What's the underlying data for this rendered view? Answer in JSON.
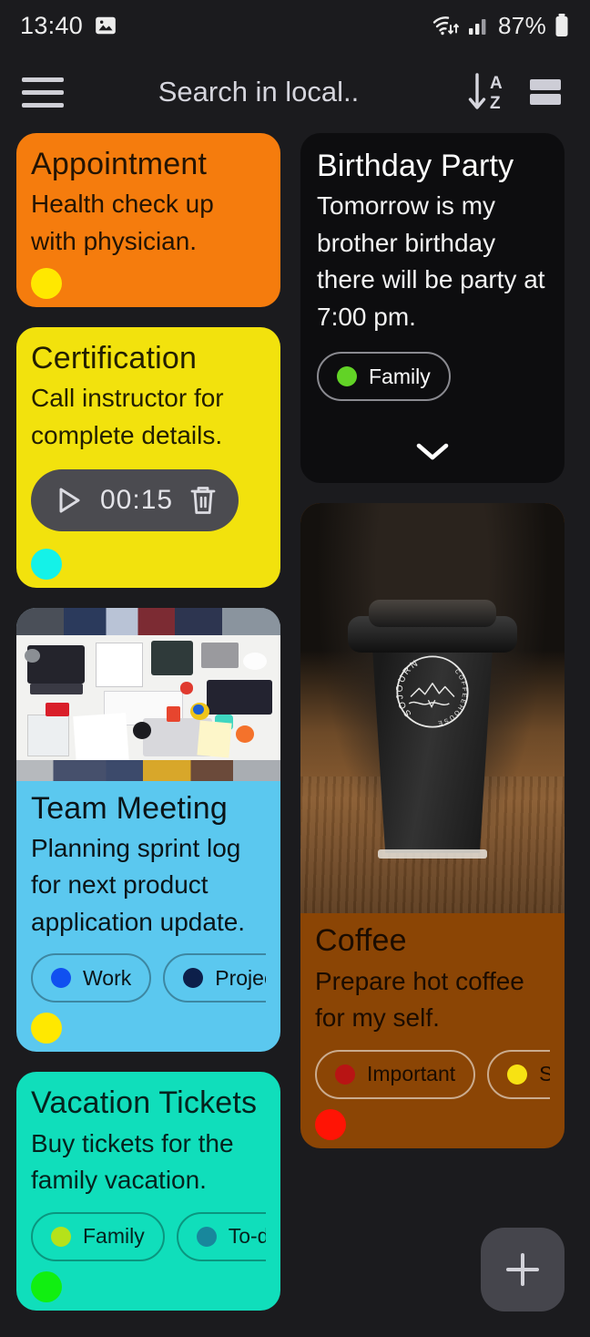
{
  "status_bar": {
    "time": "13:40",
    "battery_percent": "87%",
    "icons": [
      "image-icon",
      "wifi-icon",
      "signal-icon",
      "battery-icon"
    ]
  },
  "toolbar": {
    "menu_icon": "hamburger-menu-icon",
    "search_placeholder": "Search in local..",
    "sort_icon": "sort-a-z-icon",
    "view_toggle_icon": "list-view-icon"
  },
  "theme": {
    "background": "#1b1b1e",
    "dark_card": "#0d0d0f",
    "fab_background": "#45454c"
  },
  "notes": [
    {
      "id": "appointment",
      "title": "Appointment",
      "body": "Health check up with physician.",
      "bg": "#f57c0d",
      "text": "#241404",
      "color_dot": "#ffe800",
      "tags": [],
      "image": null
    },
    {
      "id": "certification",
      "title": "Certification",
      "body": "Call instructor for complete details.",
      "bg": "#f2e20d",
      "text": "#231f02",
      "color_dot": "#14f2e8",
      "tags": [],
      "audio": {
        "duration": "00:15",
        "play_icon": "play-icon",
        "delete_icon": "trash-icon"
      },
      "image": null
    },
    {
      "id": "team-meeting",
      "title": "Team Meeting",
      "body": "Planning sprint log for next product application update.",
      "bg": "#5bc8ef",
      "text": "#0b1418",
      "color_dot": "#ffe800",
      "image": "team-meeting-photo",
      "tags": [
        {
          "label": "Work",
          "dot": "#1050f0"
        },
        {
          "label": "Project",
          "dot": "#0d1f4a"
        },
        {
          "label": "",
          "dot": ""
        }
      ]
    },
    {
      "id": "vacation-tickets",
      "title": "Vacation Tickets",
      "body": "Buy tickets for the family vacation.",
      "bg": "#10debb",
      "text": "#05231e",
      "color_dot": "#11ef11",
      "image": null,
      "tags": [
        {
          "label": "Family",
          "dot": "#b5e21a"
        },
        {
          "label": "To-do",
          "dot": "#18879c"
        },
        {
          "label": "",
          "dot": ""
        }
      ]
    },
    {
      "id": "birthday-party",
      "title": "Birthday Party",
      "body": "Tomorrow is my brother birthday there will be party at 7:00 pm.",
      "bg": "#0d0d0f",
      "text": "#ffffff",
      "color_dot": null,
      "image": null,
      "expand_icon": "chevron-down-icon",
      "tags": [
        {
          "label": "Family",
          "dot": "#62d326"
        }
      ]
    },
    {
      "id": "coffee",
      "title": "Coffee",
      "body": "Prepare hot coffee for my self.",
      "bg": "#8b4505",
      "text": "#1b0c01",
      "color_dot": "#ff1405",
      "image": "coffee-cup-photo",
      "image_logo_text": "SOJOURN COFFEEHOUSE",
      "tags": [
        {
          "label": "Important",
          "dot": "#b81414"
        },
        {
          "label": "Solo",
          "dot": "#f7e213"
        }
      ]
    }
  ],
  "fab": {
    "icon": "plus-icon",
    "label": "+"
  }
}
